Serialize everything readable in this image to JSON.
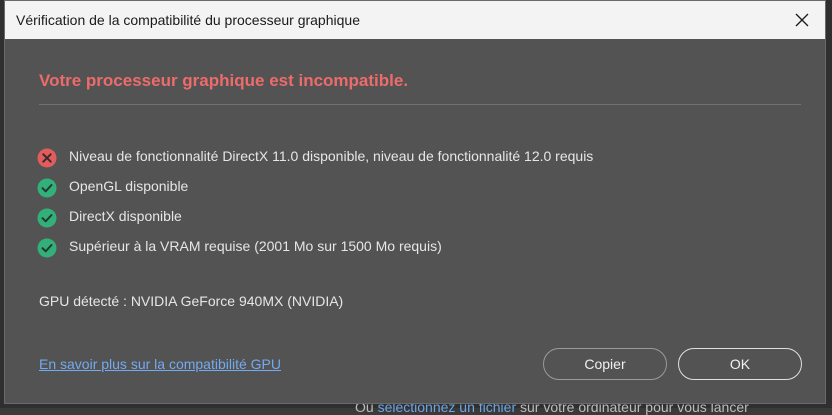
{
  "window": {
    "title": "Vérification de la compatibilité du processeur graphique"
  },
  "main": {
    "heading": "Votre processeur graphique est incompatible.",
    "checks": [
      {
        "status": "fail",
        "icon": "error-x-icon",
        "label": "Niveau de fonctionnalité DirectX 11.0 disponible, niveau de fonctionnalité 12.0 requis"
      },
      {
        "status": "pass",
        "icon": "success-check-icon",
        "label": "OpenGL disponible"
      },
      {
        "status": "pass",
        "icon": "success-check-icon",
        "label": "DirectX disponible"
      },
      {
        "status": "pass",
        "icon": "success-check-icon",
        "label": "Supérieur à la VRAM requise (2001 Mo sur 1500 Mo requis)"
      }
    ],
    "gpu_detected": "GPU détecté : NVIDIA GeForce 940MX (NVIDIA)"
  },
  "footer": {
    "help_link": "En savoir plus sur la compatibilité GPU",
    "copy_label": "Copier",
    "ok_label": "OK"
  },
  "background": {
    "text_prefix": "Ou ",
    "link_text": "sélectionnez un fichier",
    "text_suffix": " sur votre ordinateur pour vous lancer"
  },
  "colors": {
    "heading": "#ee6b6b",
    "fail": "#e05d5d",
    "pass": "#33b07a",
    "link": "#73aaf0",
    "dialog_bg": "#535353"
  }
}
